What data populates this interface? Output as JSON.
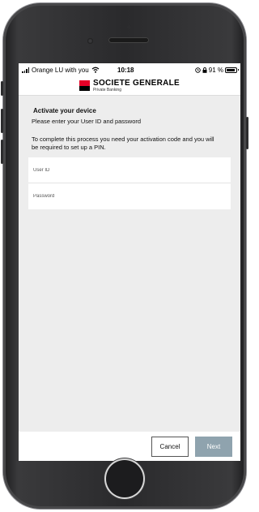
{
  "status_bar": {
    "carrier": "Orange LU with you",
    "time": "10:18",
    "battery": "91 %"
  },
  "brand": {
    "name": "SOCIETE GENERALE",
    "sub": "Private Banking"
  },
  "page": {
    "title": "Activate your device",
    "subtitle": "Please enter your User ID and password",
    "info": "To complete this process you need your activation code and you will be required to set up a PIN."
  },
  "form": {
    "user_id_placeholder": "User ID",
    "password_placeholder": "Password"
  },
  "actions": {
    "cancel_label": "Cancel",
    "next_label": "Next"
  },
  "icons": [
    "signal-icon",
    "wifi-icon",
    "alarm-icon",
    "lock-icon",
    "battery-icon"
  ],
  "colors": {
    "brand_red": "#e60028",
    "next_button": "#8fa3ae",
    "background": "#ededed"
  }
}
